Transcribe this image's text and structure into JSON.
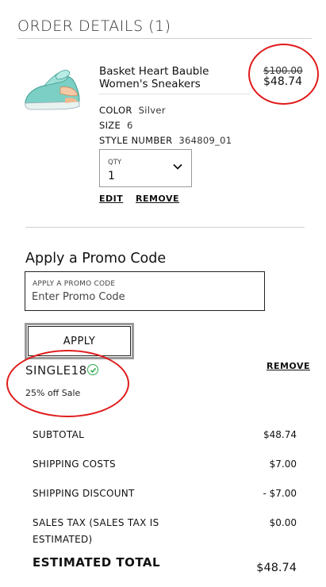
{
  "order": {
    "title": "ORDER DETAILS (1)",
    "item": {
      "name": "Basket Heart Bauble Women's Sneakers",
      "original_price": "$100.00",
      "sale_price": "$48.74",
      "color_label": "COLOR",
      "color_value": "Silver",
      "size_label": "SIZE",
      "size_value": "6",
      "style_label": "STYLE NUMBER",
      "style_value": "364809_01",
      "qty_label": "QTY",
      "qty_value": "1",
      "edit_label": "EDIT",
      "remove_label": "REMOVE"
    }
  },
  "promo": {
    "heading": "Apply a Promo Code",
    "field_label": "APPLY A PROMO CODE",
    "placeholder": "Enter Promo Code",
    "apply_label": "APPLY",
    "applied_code": "SINGLE18",
    "applied_desc": "25% off Sale",
    "remove_label": "REMOVE"
  },
  "summary": {
    "subtotal_label": "SUBTOTAL",
    "subtotal_value": "$48.74",
    "shipping_label": "SHIPPING COSTS",
    "shipping_value": "$7.00",
    "discount_label": "SHIPPING DISCOUNT",
    "discount_value": "- $7.00",
    "tax_label_1": "SALES TAX (SALES TAX IS",
    "tax_label_2": "ESTIMATED)",
    "tax_value": "$0.00",
    "total_label": "ESTIMATED TOTAL",
    "total_value": "$48.74"
  },
  "colors": {
    "annotation_circle": "#e01b1b",
    "success_check": "#2ba84a"
  },
  "icons": {
    "qty_dropdown": "chevron-down-icon",
    "applied_status": "check-circle-icon"
  }
}
